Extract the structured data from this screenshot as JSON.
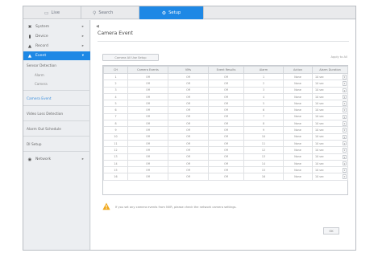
{
  "tabs": [
    {
      "label": "Live",
      "icon": "monitor-icon"
    },
    {
      "label": "Search",
      "icon": "search-icon"
    },
    {
      "label": "Setup",
      "icon": "gear-icon"
    }
  ],
  "sidebar": {
    "sections": [
      {
        "label": "System",
        "icon": "tools-icon"
      },
      {
        "label": "Device",
        "icon": "camera-icon"
      },
      {
        "label": "Record",
        "icon": "record-icon"
      },
      {
        "label": "Event",
        "icon": "event-icon"
      }
    ],
    "sensor_detection": "Sensor Detection",
    "sensor_alarm": "Alarm",
    "sensor_camera": "Camera",
    "camera_event": "Camera Event",
    "video_loss": "Video Loss Detection",
    "alarm_out": "Alarm Out Schedule",
    "di_setup": "DI Setup",
    "network": "Network"
  },
  "page": {
    "title": "Camera Event",
    "camera_all_setup": "Camera All Use Setup",
    "apply_to_all": "Apply to All",
    "warning": "If you set any camera events from NVR, please check the network camera settings.",
    "ok": "OK"
  },
  "table": {
    "headers": [
      "CH",
      "Camera Events",
      "VMs",
      "Event Results",
      "Alarm",
      "Action",
      "Alarm Duration"
    ],
    "rows": [
      [
        "1",
        "Off",
        "Off",
        "Off",
        "1",
        "None",
        "10 sec"
      ],
      [
        "2",
        "Off",
        "Off",
        "Off",
        "2",
        "None",
        "10 sec"
      ],
      [
        "3",
        "Off",
        "Off",
        "Off",
        "3",
        "None",
        "10 sec"
      ],
      [
        "4",
        "Off",
        "Off",
        "Off",
        "4",
        "None",
        "10 sec"
      ],
      [
        "5",
        "Off",
        "Off",
        "Off",
        "5",
        "None",
        "10 sec"
      ],
      [
        "6",
        "Off",
        "Off",
        "Off",
        "6",
        "None",
        "10 sec"
      ],
      [
        "7",
        "Off",
        "Off",
        "Off",
        "7",
        "None",
        "10 sec"
      ],
      [
        "8",
        "Off",
        "Off",
        "Off",
        "8",
        "None",
        "10 sec"
      ],
      [
        "9",
        "Off",
        "Off",
        "Off",
        "9",
        "None",
        "10 sec"
      ],
      [
        "10",
        "Off",
        "Off",
        "Off",
        "10",
        "None",
        "10 sec"
      ],
      [
        "11",
        "Off",
        "Off",
        "Off",
        "11",
        "None",
        "10 sec"
      ],
      [
        "12",
        "Off",
        "Off",
        "Off",
        "12",
        "None",
        "10 sec"
      ],
      [
        "13",
        "Off",
        "Off",
        "Off",
        "13",
        "None",
        "10 sec"
      ],
      [
        "14",
        "Off",
        "Off",
        "Off",
        "14",
        "None",
        "10 sec"
      ],
      [
        "15",
        "Off",
        "Off",
        "Off",
        "15",
        "None",
        "10 sec"
      ],
      [
        "16",
        "Off",
        "Off",
        "Off",
        "16",
        "None",
        "10 sec"
      ]
    ]
  },
  "colors": {
    "accent": "#1e88e5",
    "warning": "#f0a81c"
  }
}
